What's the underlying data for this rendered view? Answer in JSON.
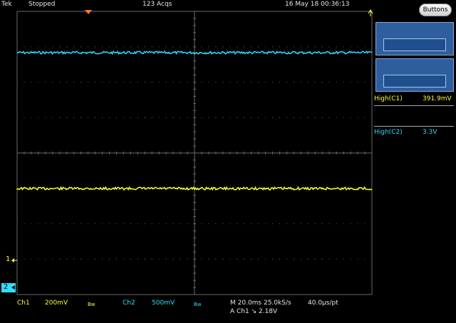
{
  "status_bar": {
    "brand": "Tek",
    "run_state": "Stopped",
    "acquisitions": "123 Acqs",
    "datetime": "16 May 18 00:36:13"
  },
  "side_panel": {
    "buttons_label": "Buttons",
    "measurements": [
      {
        "label": "High(C1)",
        "value": "391.9mV"
      },
      {
        "label": "High(C2)",
        "value": "3.3V"
      }
    ]
  },
  "markers": {
    "ch1": "1",
    "ch2": "2"
  },
  "bottom_bar": {
    "ch1_name": "Ch1",
    "ch1_scale": "200mV",
    "ch1_bw": "Bw",
    "ch2_name": "Ch2",
    "ch2_scale": "500mV",
    "ch2_bw": "Bw",
    "horizontal": "M 20.0ms 25.0kS/s",
    "trigger": "A  Ch1  ↘  2.18V",
    "resolution": "40.0µs/pt"
  },
  "colors": {
    "ch1": "#ffff33",
    "ch2": "#33ddff",
    "grid": "#6a6a6a",
    "panel": "#2f5e9e"
  }
}
